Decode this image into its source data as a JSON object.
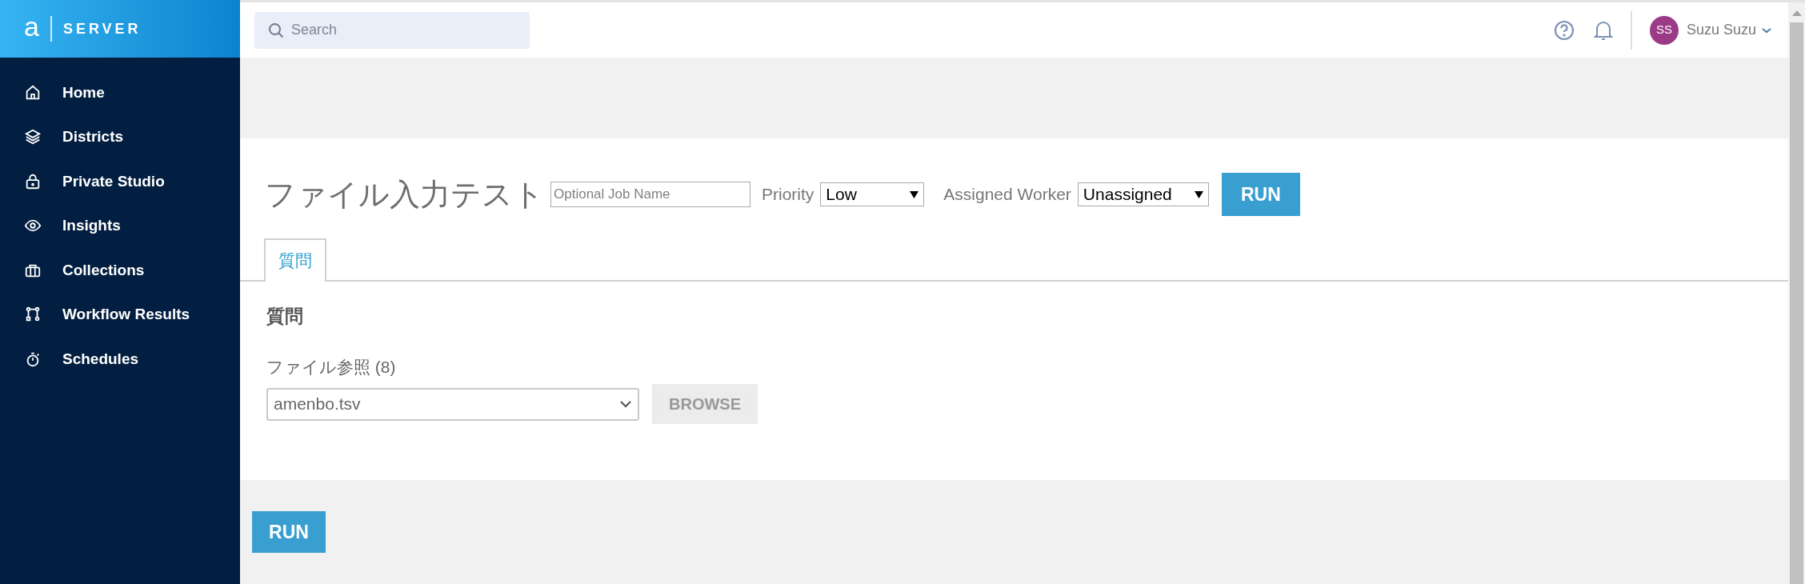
{
  "brand": {
    "logo": "a",
    "name": "SERVER"
  },
  "sidebar": {
    "items": [
      {
        "label": "Home"
      },
      {
        "label": "Districts"
      },
      {
        "label": "Private Studio"
      },
      {
        "label": "Insights"
      },
      {
        "label": "Collections"
      },
      {
        "label": "Workflow Results"
      },
      {
        "label": "Schedules"
      }
    ]
  },
  "header": {
    "search": {
      "placeholder": "Search"
    },
    "user": {
      "initials": "SS",
      "name": "Suzu Suzu"
    }
  },
  "job": {
    "title": "ファイル入力テスト",
    "job_name": {
      "placeholder": "Optional Job Name"
    },
    "priority_label": "Priority",
    "priority": "Low",
    "worker_label": "Assigned Worker",
    "worker": "Unassigned",
    "run": "RUN"
  },
  "tabs": [
    {
      "label": "質問",
      "selected": true
    }
  ],
  "section": {
    "heading": "質問",
    "field_label": "ファイル参照 (8)",
    "file": "amenbo.tsv",
    "browse": "BROWSE"
  },
  "footer": {
    "run": "RUN"
  }
}
